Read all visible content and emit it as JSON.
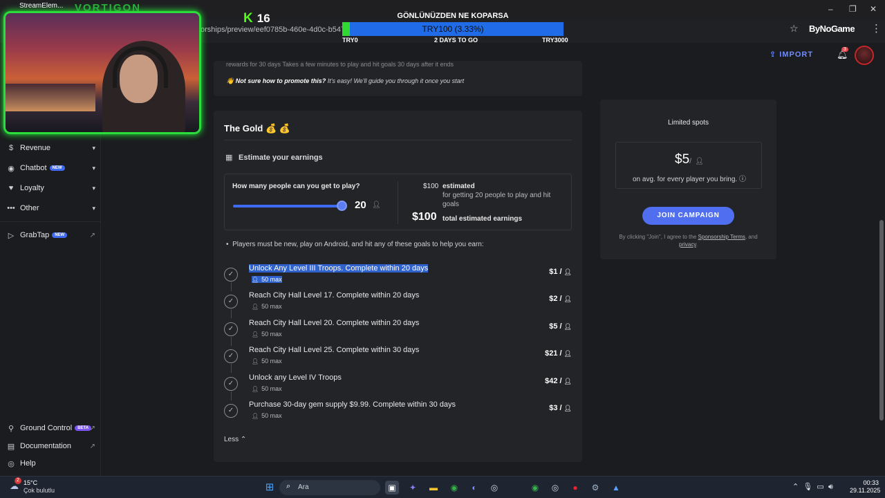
{
  "browser": {
    "url": "orships/preview/eef0785b-460e-4d0c-b547-448d9",
    "extension_logo": "ByNoGame",
    "menu_icon": "⋮",
    "star_icon": "☆",
    "window_controls": [
      "–",
      "❐",
      "✕"
    ]
  },
  "overlay": {
    "webcam_title": "StreamElem...",
    "brand": "VORTIGON",
    "kick_count": "16",
    "donation": {
      "title": "GÖNLÜNÜZDEN NE KOPARSA",
      "progress_text": "TRY100 (3.33%)",
      "progress": 0.0333,
      "left_label": "TRY0",
      "middle_label": "2 DAYS TO GO",
      "right_label": "TRY3000"
    }
  },
  "header": {
    "import_label": "IMPORT",
    "notification_count": "3"
  },
  "sidebar": {
    "items": [
      {
        "label": "Revenue",
        "icon": "dollar-icon"
      },
      {
        "label": "Chatbot",
        "badge": "NEW",
        "icon": "chatbot-icon"
      },
      {
        "label": "Loyalty",
        "icon": "loyalty-icon"
      },
      {
        "label": "Other",
        "icon": "dots-icon"
      },
      {
        "label": "GrabTap",
        "badge": "NEW",
        "icon": "grabtap-icon"
      }
    ],
    "bottom": [
      {
        "label": "Ground Control",
        "badge": "BETA"
      },
      {
        "label": "Documentation"
      },
      {
        "label": "Help"
      }
    ]
  },
  "prev_card": {
    "snippets": "rewards for 30 days          Takes a few minutes          to play and hit goals          30 days after it ends",
    "promote_bold": "Not sure how to promote this?",
    "promote_rest": "It's easy! We'll guide you through it once you start"
  },
  "gold": {
    "title": "The Gold 💰 💰",
    "estimate_label": "Estimate your earnings",
    "question": "How many people can you get to play?",
    "player_count": "20",
    "slider_fraction": 1.0,
    "est_small_amount": "$100",
    "est_small_label": "estimated",
    "est_desc": "for getting 20 people to play and hit goals",
    "est_big_amount": "$100",
    "est_big_label": "total estimated earnings",
    "rules": "Players must be new, play on Android, and hit any of these goals to help you earn:",
    "goals": [
      {
        "title": "Unlock Any Level III Troops. Complete within 20 days",
        "max": "50 max",
        "amount": "$1 /",
        "selected": true
      },
      {
        "title": "Reach City Hall Level 17. Complete within 20 days",
        "max": "50 max",
        "amount": "$2 /"
      },
      {
        "title": "Reach City Hall Level 20. Complete within 20 days",
        "max": "50 max",
        "amount": "$5 /"
      },
      {
        "title": "Reach City Hall Level 25. Complete within 30 days",
        "max": "50 max",
        "amount": "$21 /"
      },
      {
        "title": "Unlock any Level IV Troops",
        "max": "50 max",
        "amount": "$42 /"
      },
      {
        "title": "Purchase 30-day gem supply $9.99. Complete within 30 days",
        "max": "50 max",
        "amount": "$3 /"
      }
    ],
    "less_label": "Less"
  },
  "right": {
    "limited_spots": "Limited spots",
    "price": "$5",
    "price_suffix": "/",
    "price_desc": "on avg. for every player you bring.",
    "join_label": "JOIN CAMPAIGN",
    "terms_pre": "By clicking \"Join\", I agree to the",
    "terms_link": "Sponsorship Terms",
    "terms_mid": ", and",
    "privacy_link": "privacy"
  },
  "taskbar": {
    "weather_temp": "15°C",
    "weather_desc": "Çok bulutlu",
    "weather_badge": "2",
    "search_placeholder": "Ara",
    "time": "00:33",
    "date": "29.11.2025"
  },
  "colors": {
    "accent": "#4f6ff0",
    "selection": "#2f62cc",
    "kick_green": "#53fc18",
    "donation_fill": "#31d832",
    "donation_bar": "#1f6be8"
  }
}
